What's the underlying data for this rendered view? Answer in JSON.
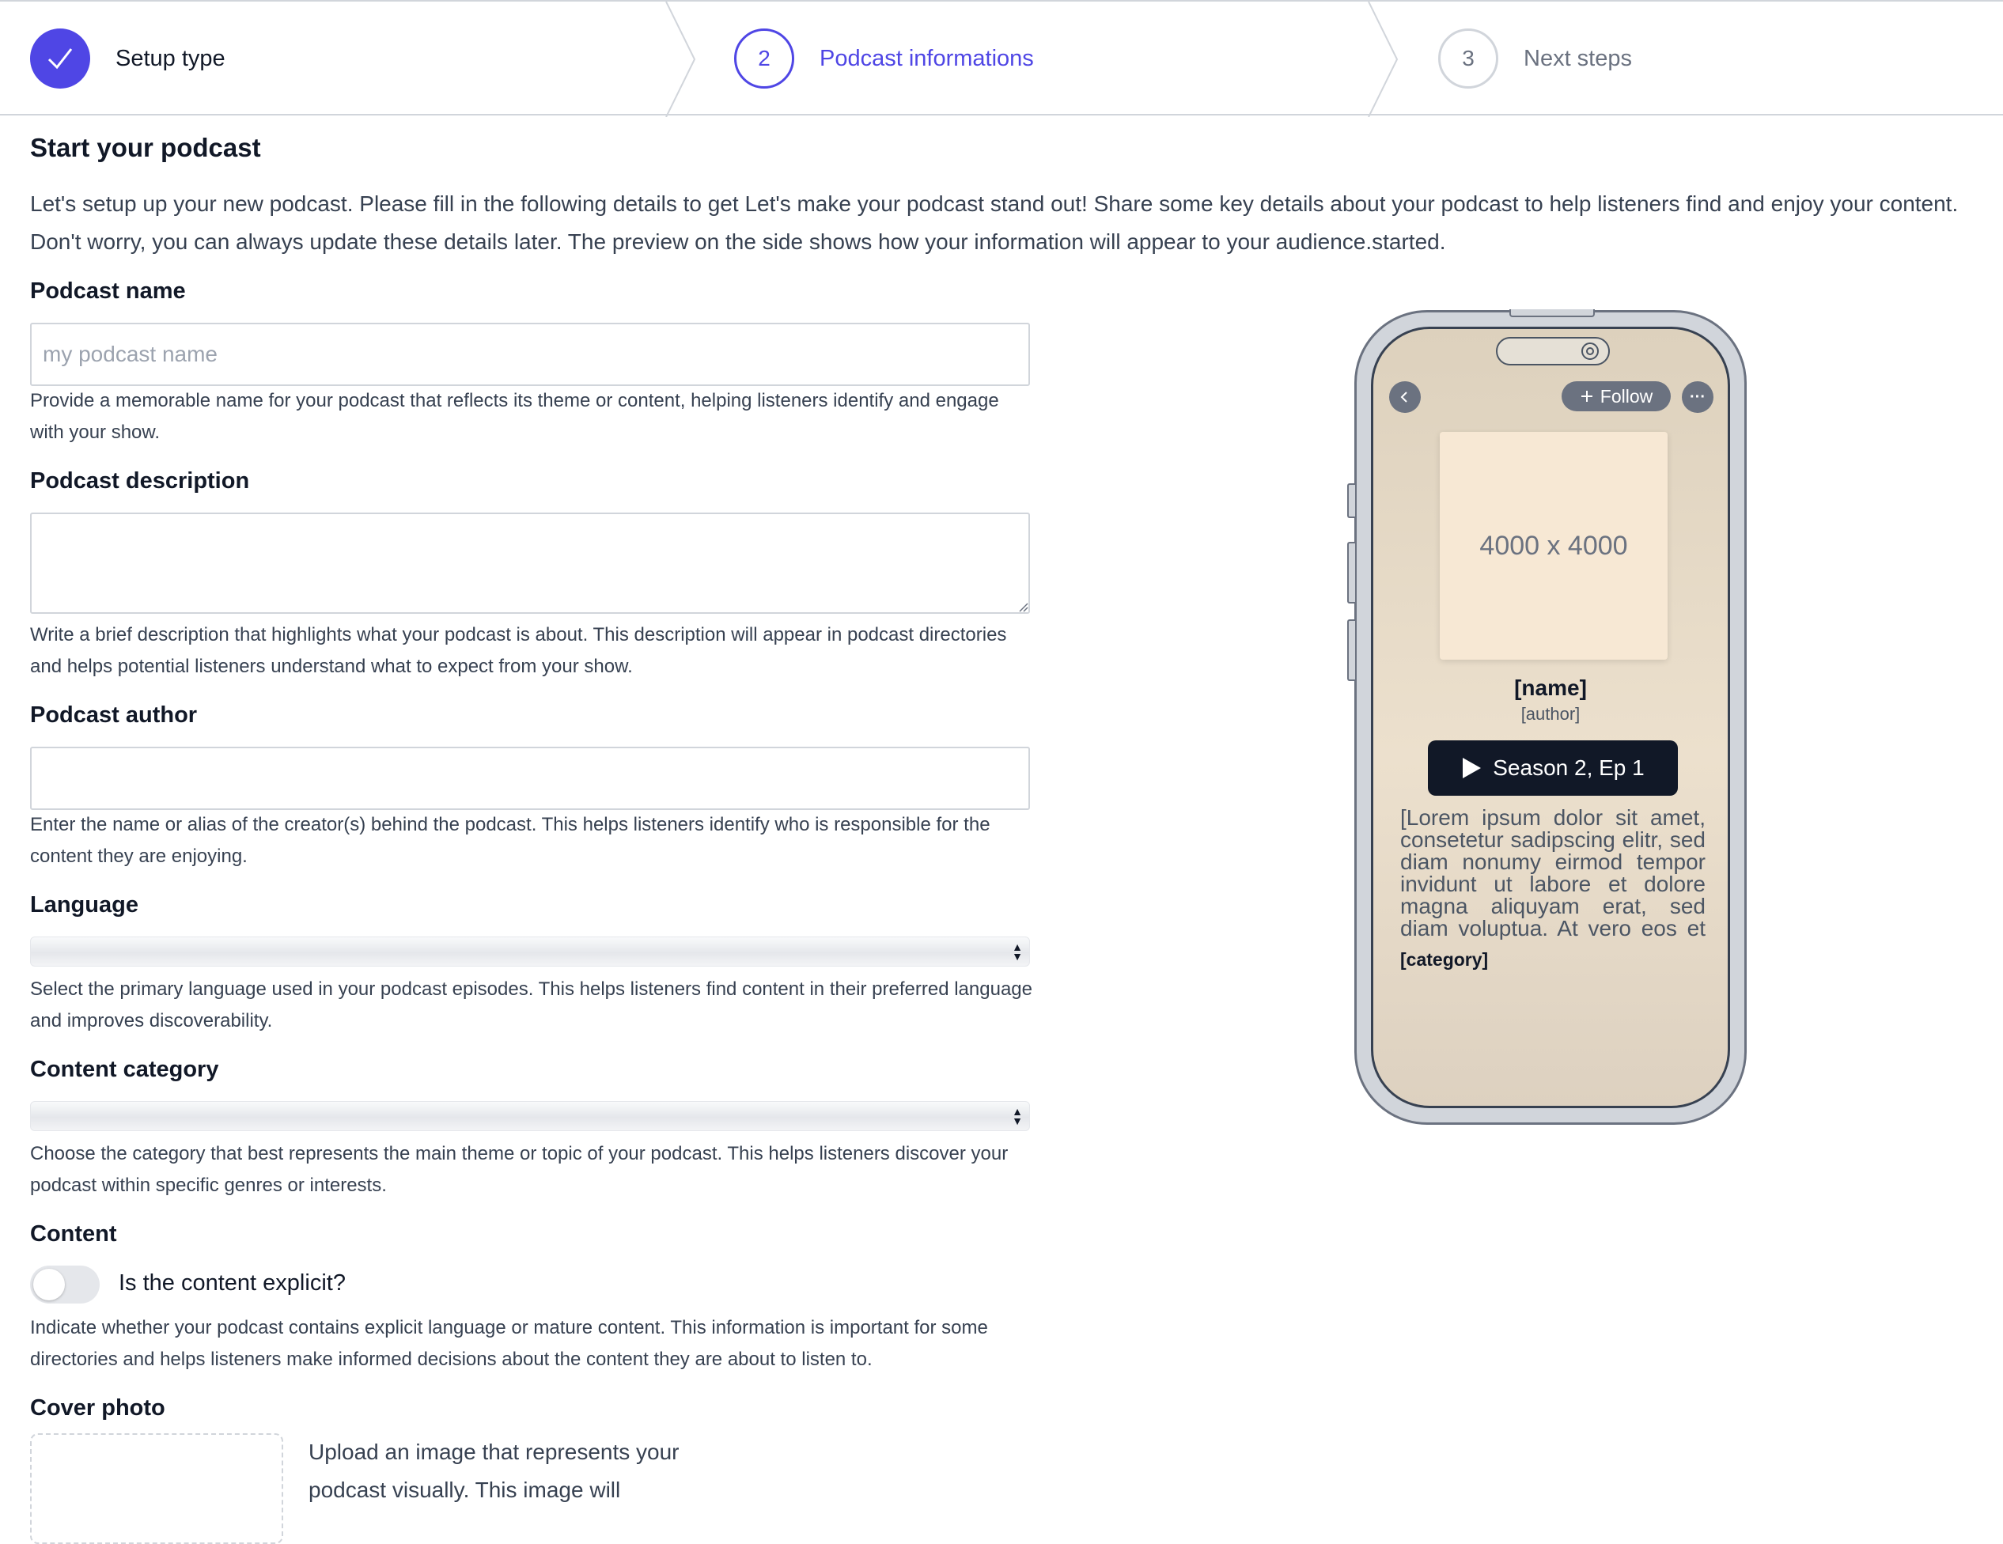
{
  "stepper": {
    "steps": [
      {
        "label": "Setup type",
        "number": "",
        "state": "done"
      },
      {
        "label": "Podcast informations",
        "number": "2",
        "state": "current"
      },
      {
        "label": "Next steps",
        "number": "3",
        "state": "todo"
      }
    ]
  },
  "page": {
    "title": "Start your podcast",
    "intro_line1": "Let's setup up your new podcast. Please fill in the following details to get Let's make your podcast stand out! Share some key details about your podcast to help listeners find and enjoy your content.",
    "intro_line2": "Don't worry, you can always update these details later. The preview on the side shows how your information will appear to your audience.started."
  },
  "form": {
    "name": {
      "label": "Podcast name",
      "placeholder": "my podcast name",
      "value": "",
      "help": "Provide a memorable name for your podcast that reflects its theme or content, helping listeners identify and engage with your show."
    },
    "description": {
      "label": "Podcast description",
      "value": "",
      "help": "Write a brief description that highlights what your podcast is about. This description will appear in podcast directories and helps potential listeners understand what to expect from your show."
    },
    "author": {
      "label": "Podcast author",
      "value": "",
      "help": "Enter the name or alias of the creator(s) behind the podcast. This helps listeners identify who is responsible for the content they are enjoying."
    },
    "language": {
      "label": "Language",
      "selected": "",
      "help": "Select the primary language used in your podcast episodes. This helps listeners find content in their preferred language and improves discoverability."
    },
    "category": {
      "label": "Content category",
      "selected": "",
      "help": "Choose the category that best represents the main theme or topic of your podcast. This helps listeners discover your podcast within specific genres or interests."
    },
    "content": {
      "label": "Content",
      "toggle_label": "Is the content explicit?",
      "explicit": false,
      "help": "Indicate whether your podcast contains explicit language or mature content. This information is important for some directories and helps listeners make informed decisions about the content they are about to listen to."
    },
    "cover": {
      "label": "Cover photo",
      "help": "Upload an image that represents your podcast visually. This image will"
    }
  },
  "preview": {
    "back_icon": "chevron-left-icon",
    "follow_label": "Follow",
    "follow_icon": "plus-icon",
    "more_label": "···",
    "cover_placeholder": "4000 x 4000",
    "name": "[name]",
    "author": "[author]",
    "play_label": "Season 2, Ep 1",
    "description": "[Lorem ipsum dolor sit amet, consetetur sadipscing elitr, sed diam nonumy eirmod tempor invidunt ut labore et dolore magna aliquyam erat, sed diam voluptua. At vero eos et accusam et justo duo dolores et ea rebum.]",
    "category": "[category]"
  },
  "colors": {
    "accent": "#4f46e5",
    "border": "#d1d5db",
    "muted_text": "#6b7280",
    "play_button": "#111827",
    "preview_background": "#ece0cd"
  }
}
